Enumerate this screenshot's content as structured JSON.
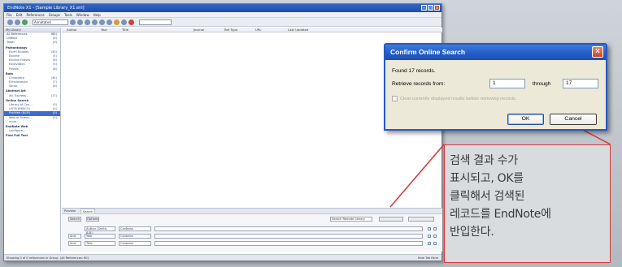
{
  "app": {
    "title": "EndNote X1 - [Sample Library_X1.enl]",
    "menu": [
      "File",
      "Edit",
      "References",
      "Groups",
      "Tools",
      "Window",
      "Help"
    ],
    "style_select": "Annotated",
    "columns": [
      "Author",
      "Year",
      "Title",
      "Journal",
      "Ref Type",
      "URL",
      "Last Updated"
    ]
  },
  "groups": {
    "header": "My Library",
    "items": [
      {
        "label": "All References",
        "count": "(60)",
        "kind": "item"
      },
      {
        "label": "Unfiled",
        "count": "(0)",
        "kind": "item"
      },
      {
        "label": "Trash",
        "count": "(0)",
        "kind": "item"
      },
      {
        "label": "Paleontology",
        "count": "",
        "kind": "section"
      },
      {
        "label": "Earth Studies",
        "count": "(30)",
        "kind": "sub"
      },
      {
        "label": "Eocene",
        "count": "(5)",
        "kind": "sub"
      },
      {
        "label": "Eocene Fossils",
        "count": "(6)",
        "kind": "sub"
      },
      {
        "label": "Excavation",
        "count": "(5)",
        "kind": "sub"
      },
      {
        "label": "Fossils",
        "count": "(8)",
        "kind": "sub"
      },
      {
        "label": "Bats",
        "count": "",
        "kind": "section"
      },
      {
        "label": "Chiroptera",
        "count": "(34)",
        "kind": "sub"
      },
      {
        "label": "Echolocation",
        "count": "(7)",
        "kind": "sub"
      },
      {
        "label": "Sonar",
        "count": "(6)",
        "kind": "sub"
      },
      {
        "label": "Abstract Art",
        "count": "",
        "kind": "section"
      },
      {
        "label": "Ab. Express...",
        "count": "(17)",
        "kind": "sub"
      },
      {
        "label": "Online Search",
        "count": "",
        "kind": "section"
      },
      {
        "label": "Library of Con...",
        "count": "(0)",
        "kind": "sub"
      },
      {
        "label": "LISTA (EBSCO)",
        "count": "(0)",
        "kind": "sub"
      },
      {
        "label": "PubMed (NLM)",
        "count": "(0)",
        "kind": "sel"
      },
      {
        "label": "Web of Scienc...",
        "count": "(0)",
        "kind": "sub"
      },
      {
        "label": "more...",
        "count": "",
        "kind": "sub"
      },
      {
        "label": "EndNote Web",
        "count": "",
        "kind": "section"
      },
      {
        "label": "configure...",
        "count": "",
        "kind": "sub"
      },
      {
        "label": "Find Full Text",
        "count": "",
        "kind": "section"
      }
    ]
  },
  "search_pane": {
    "tabs": [
      "Preview",
      "Search"
    ],
    "search_button": "Search",
    "options_button": "Options",
    "mode_select": "Search Remote Library",
    "rows": [
      {
        "bool": "",
        "field": "Author (Smith, A.B.)",
        "op": "Contains",
        "value": ""
      },
      {
        "bool": "And",
        "field": "Year",
        "op": "Contains",
        "value": ""
      },
      {
        "bool": "And",
        "field": "Title",
        "op": "Contains",
        "value": ""
      }
    ]
  },
  "status": {
    "left": "Showing 0 of 0 references in Group. (All References: 60)",
    "right": "Hide Tab Pane"
  },
  "dialog": {
    "title": "Confirm Online Search",
    "found_text": "Found 17 records.",
    "retrieve_label": "Retrieve records from:",
    "from_value": "1",
    "through_label": "through",
    "through_value": "17",
    "checkbox_label": "Clear currently displayed results before retrieving records.",
    "ok_label": "OK",
    "cancel_label": "Cancel"
  },
  "callout": {
    "text": "검색 결과 수가\n표시되고, OK를\n클릭해서 검색된\n레코드를 EndNote에\n반입한다."
  },
  "colors": {
    "dialog_title": "#225bc7",
    "callout_border": "#d93535",
    "selection": "#3c6ccf"
  }
}
